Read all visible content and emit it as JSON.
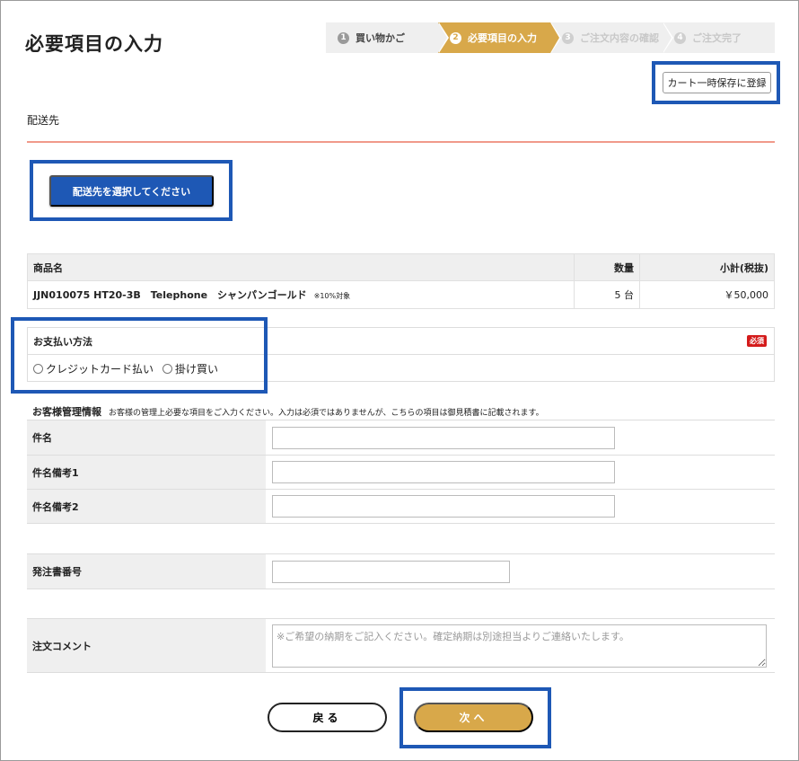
{
  "page_title": "必要項目の入力",
  "steps": [
    {
      "num": "1",
      "label": "買い物かご"
    },
    {
      "num": "2",
      "label": "必要項目の入力"
    },
    {
      "num": "3",
      "label": "ご注文内容の確認"
    },
    {
      "num": "4",
      "label": "ご注文完了"
    }
  ],
  "save_cart_label": "カート一時保存に登録",
  "shipping": {
    "section_label": "配送先",
    "select_button": "配送先を選択してください"
  },
  "product_table": {
    "headers": {
      "name": "商品名",
      "qty": "数量",
      "subtotal": "小計(税抜)"
    },
    "rows": [
      {
        "name": "JJN010075 HT20-3B　Telephone　シャンパンゴールド",
        "tax_note": "※10%対象",
        "qty": "5 台",
        "subtotal": "￥50,000"
      }
    ]
  },
  "payment": {
    "title": "お支払い方法",
    "required_badge": "必須",
    "options": [
      "クレジットカード払い",
      "掛け買い"
    ]
  },
  "customer_info": {
    "title": "お客様管理情報",
    "description": "お客様の管理上必要な項目をご入力ください。入力は必須ではありませんが、こちらの項目は御見積書に記載されます。",
    "fields": {
      "subject": {
        "label": "件名",
        "value": ""
      },
      "subject_note1": {
        "label": "件名備考1",
        "value": ""
      },
      "subject_note2": {
        "label": "件名備考2",
        "value": ""
      },
      "po_number": {
        "label": "発注書番号",
        "value": ""
      },
      "comment": {
        "label": "注文コメント",
        "placeholder": "※ご希望の納期をご記入ください。確定納期は別途担当よりご連絡いたします。"
      }
    }
  },
  "buttons": {
    "back": "戻る",
    "next": "次へ"
  },
  "colors": {
    "accent_gold": "#d8a84a",
    "primary_blue": "#1e58b5",
    "highlight_blue": "#1e58b5",
    "required_red": "#d41b1b"
  }
}
